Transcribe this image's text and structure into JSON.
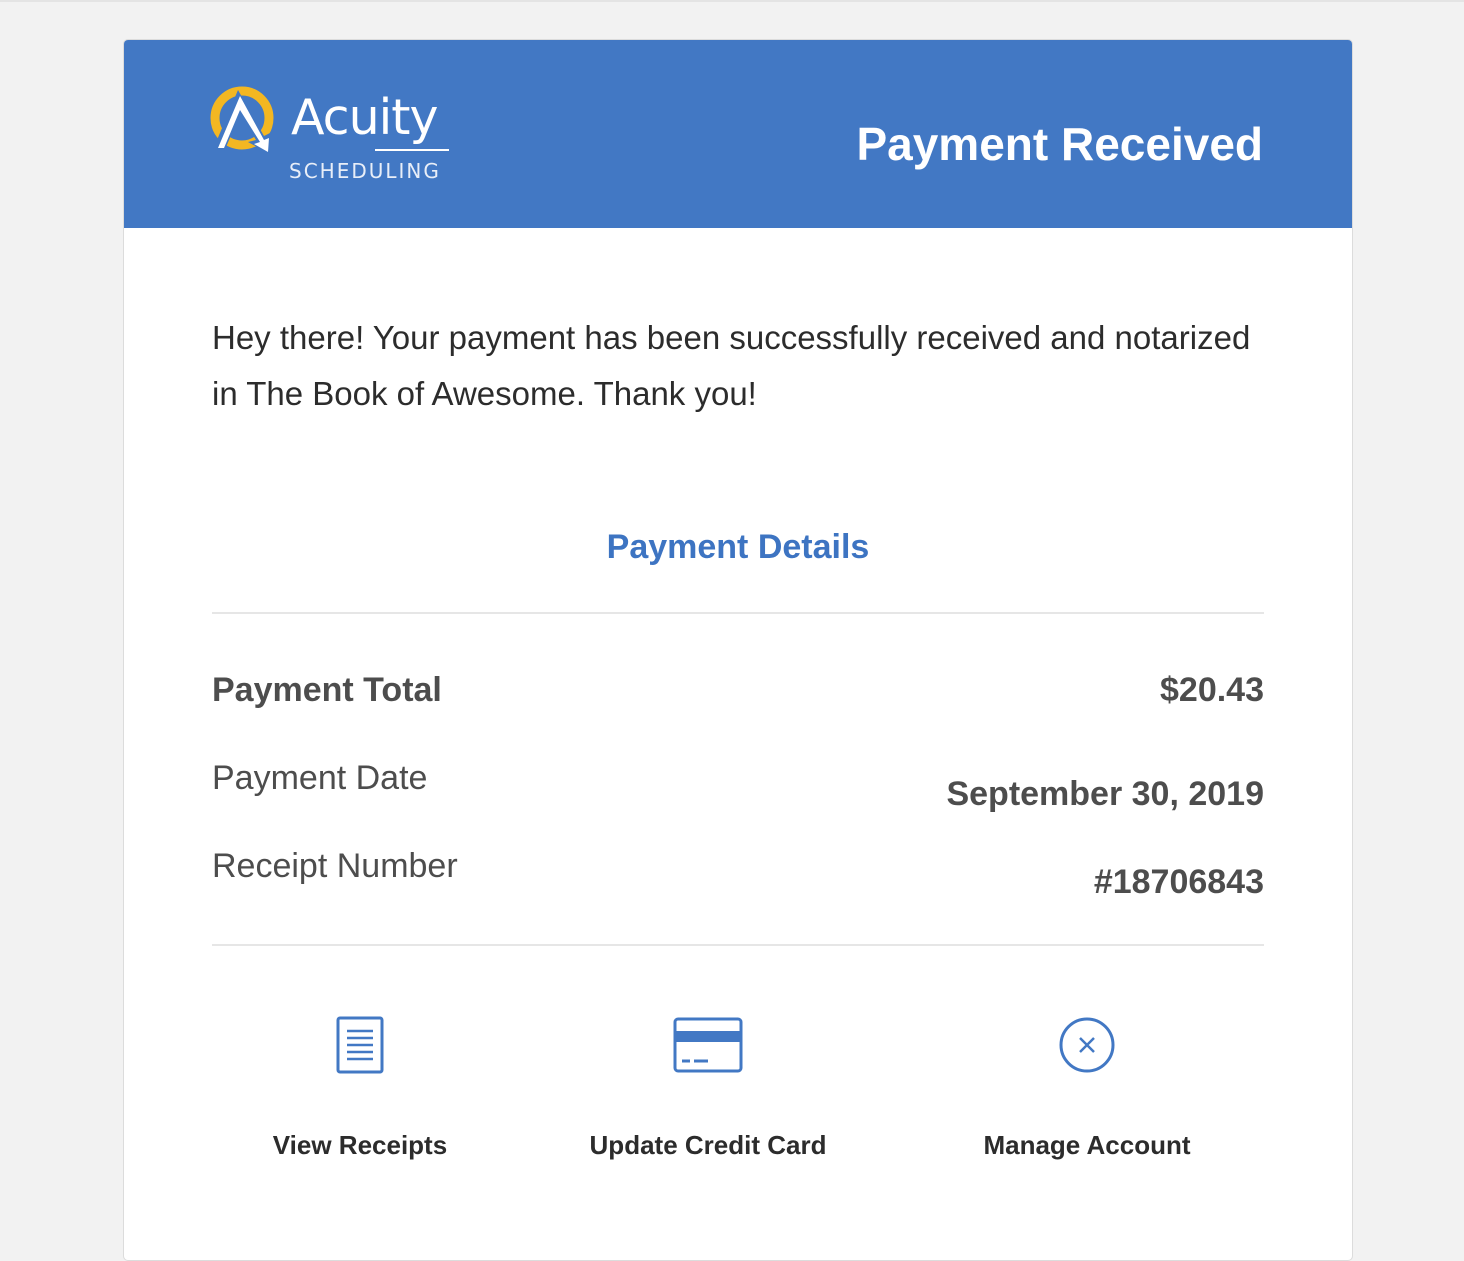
{
  "header": {
    "logo": {
      "wordmark": "Acuity",
      "subtitle": "SCHEDULING",
      "icon": "acuity-logo-icon"
    },
    "title": "Payment Received"
  },
  "intro": {
    "text": "Hey there! Your payment has been successfully received and notarized in The Book of Awesome. Thank you!"
  },
  "details": {
    "title": "Payment Details",
    "rows": [
      {
        "label": "Payment Total",
        "value": "$20.43"
      },
      {
        "label": "Payment Date",
        "value": "September 30, 2019"
      },
      {
        "label": "Receipt Number",
        "value": "#18706843"
      }
    ]
  },
  "actions": [
    {
      "label": "View Receipts",
      "icon": "receipt-icon"
    },
    {
      "label": "Update Credit Card",
      "icon": "credit-card-icon"
    },
    {
      "label": "Manage Account",
      "icon": "close-circle-icon"
    }
  ],
  "colors": {
    "brand_blue": "#4278c4",
    "accent_yellow": "#f3b722",
    "link_blue": "#3d74c2",
    "background": "#f2f2f2",
    "text": "#2c2c2c",
    "muted_text": "#4d4d4d"
  }
}
